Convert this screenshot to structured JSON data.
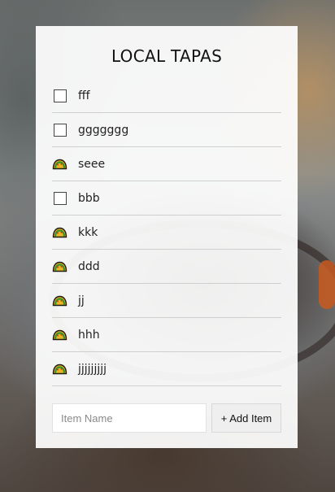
{
  "app": {
    "title": "LOCAL TAPAS"
  },
  "items": [
    {
      "label": "fff",
      "checked": false
    },
    {
      "label": "ggggggg",
      "checked": false
    },
    {
      "label": "seee",
      "checked": true
    },
    {
      "label": "bbb",
      "checked": false
    },
    {
      "label": "kkk",
      "checked": true
    },
    {
      "label": "ddd",
      "checked": true
    },
    {
      "label": "jj",
      "checked": true
    },
    {
      "label": "hhh",
      "checked": true
    },
    {
      "label": "jjjjjjjjj",
      "checked": true
    }
  ],
  "icons": {
    "unchecked": "checkbox-icon",
    "checked": "taco-icon"
  },
  "form": {
    "input_placeholder": "Item Name",
    "input_value": "",
    "add_button_label": "+ Add Item"
  }
}
